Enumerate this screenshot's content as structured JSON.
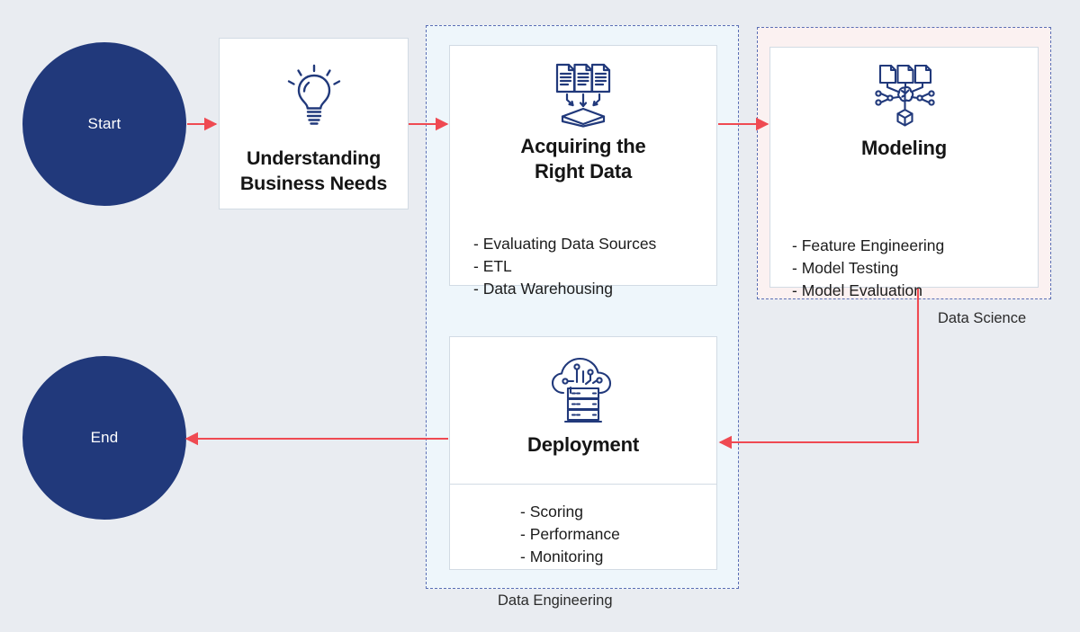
{
  "diagram": {
    "title_text_absent": true,
    "background_color": "#e9ecf1",
    "accent_color": "#21397b",
    "arrow_color": "#ef4a52"
  },
  "nodes": {
    "start": {
      "label": "Start",
      "shape": "circle",
      "fill": "#21397b",
      "text_color": "#ffffff"
    },
    "end": {
      "label": "End",
      "shape": "circle",
      "fill": "#21397b",
      "text_color": "#ffffff"
    }
  },
  "groups": [
    {
      "id": "data-engineering",
      "label": "Data Engineering",
      "fill": "#eef6fb",
      "border_color": "#5b6fb5",
      "border_style": "dashed"
    },
    {
      "id": "data-science",
      "label": "Data Science",
      "fill": "#fbf1f1",
      "border_color": "#5b6fb5",
      "border_style": "dashed"
    }
  ],
  "cards": [
    {
      "id": "understanding",
      "title": "Understanding\nBusiness Needs",
      "title_line1": "Understanding",
      "title_line2": "Business Needs",
      "icon": "lightbulb-icon",
      "items": []
    },
    {
      "id": "acquiring",
      "title_line1": "Acquiring the",
      "title_line2": "Right Data",
      "icon": "documents-into-tray-icon",
      "items": [
        "- Evaluating Data Sources",
        "- ETL",
        "- Data Warehousing"
      ]
    },
    {
      "id": "modeling",
      "title_line1": "Modeling",
      "title_line2": "",
      "icon": "neural-network-documents-icon",
      "items": [
        "- Feature Engineering",
        "- Model Testing",
        "- Model Evaluation"
      ]
    },
    {
      "id": "deployment",
      "title_line1": "Deployment",
      "title_line2": "",
      "icon": "cloud-server-icon",
      "items": [
        "- Scoring",
        "- Performance",
        "- Monitoring"
      ]
    }
  ],
  "connectors": [
    {
      "id": "start-to-understanding",
      "from": "start",
      "to": "understanding",
      "direction": "right"
    },
    {
      "id": "understanding-to-acquiring",
      "from": "understanding",
      "to": "acquiring",
      "direction": "right"
    },
    {
      "id": "acquiring-to-modeling",
      "from": "acquiring",
      "to": "modeling",
      "direction": "right"
    },
    {
      "id": "modeling-to-deployment",
      "from": "modeling",
      "to": "deployment",
      "direction": "down-left"
    },
    {
      "id": "deployment-to-end",
      "from": "deployment",
      "to": "end",
      "direction": "left"
    }
  ]
}
